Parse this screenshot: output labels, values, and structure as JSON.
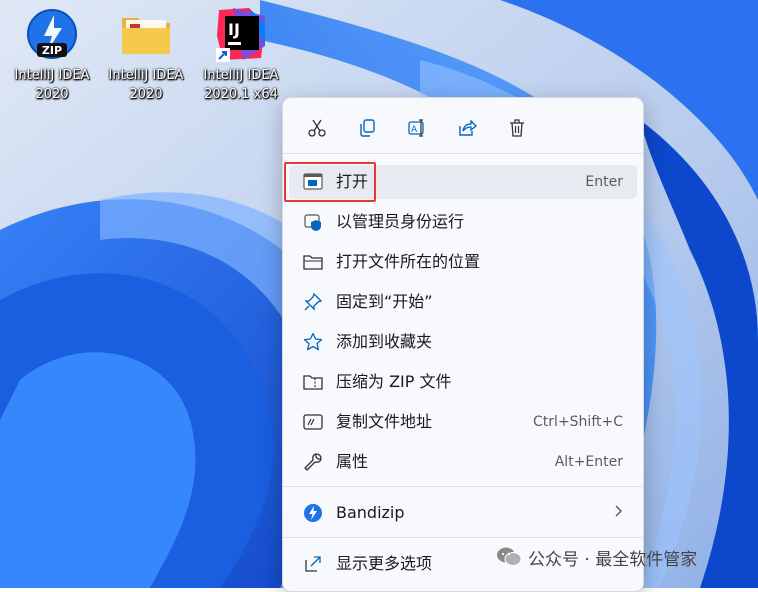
{
  "desktop": {
    "icons": [
      {
        "label": "IntelliJ IDEA\n2020",
        "icon": "bandizip-zip-icon"
      },
      {
        "label": "IntelliJ IDEA\n2020",
        "icon": "folder-icon"
      },
      {
        "label": "IntelliJ IDEA\n2020.1 x64",
        "icon": "intellij-shortcut-icon"
      }
    ]
  },
  "menu": {
    "toolbar": [
      "cut-icon",
      "copy-icon",
      "rename-icon",
      "share-icon",
      "delete-icon"
    ],
    "items": [
      {
        "label": "打开",
        "shortcut": "Enter"
      },
      {
        "label": "以管理员身份运行",
        "shortcut": ""
      },
      {
        "label": "打开文件所在的位置",
        "shortcut": ""
      },
      {
        "label": "固定到“开始”",
        "shortcut": ""
      },
      {
        "label": "添加到收藏夹",
        "shortcut": ""
      },
      {
        "label": "压缩为 ZIP 文件",
        "shortcut": ""
      },
      {
        "label": "复制文件地址",
        "shortcut": "Ctrl+Shift+C"
      },
      {
        "label": "属性",
        "shortcut": "Alt+Enter"
      },
      {
        "label": "Bandizip",
        "shortcut": ""
      },
      {
        "label": "显示更多选项",
        "shortcut": ""
      }
    ]
  },
  "watermark": {
    "text": "公众号 · 最全软件管家"
  },
  "colors": {
    "accent": "#0067c0",
    "highlight": "#e53935"
  }
}
